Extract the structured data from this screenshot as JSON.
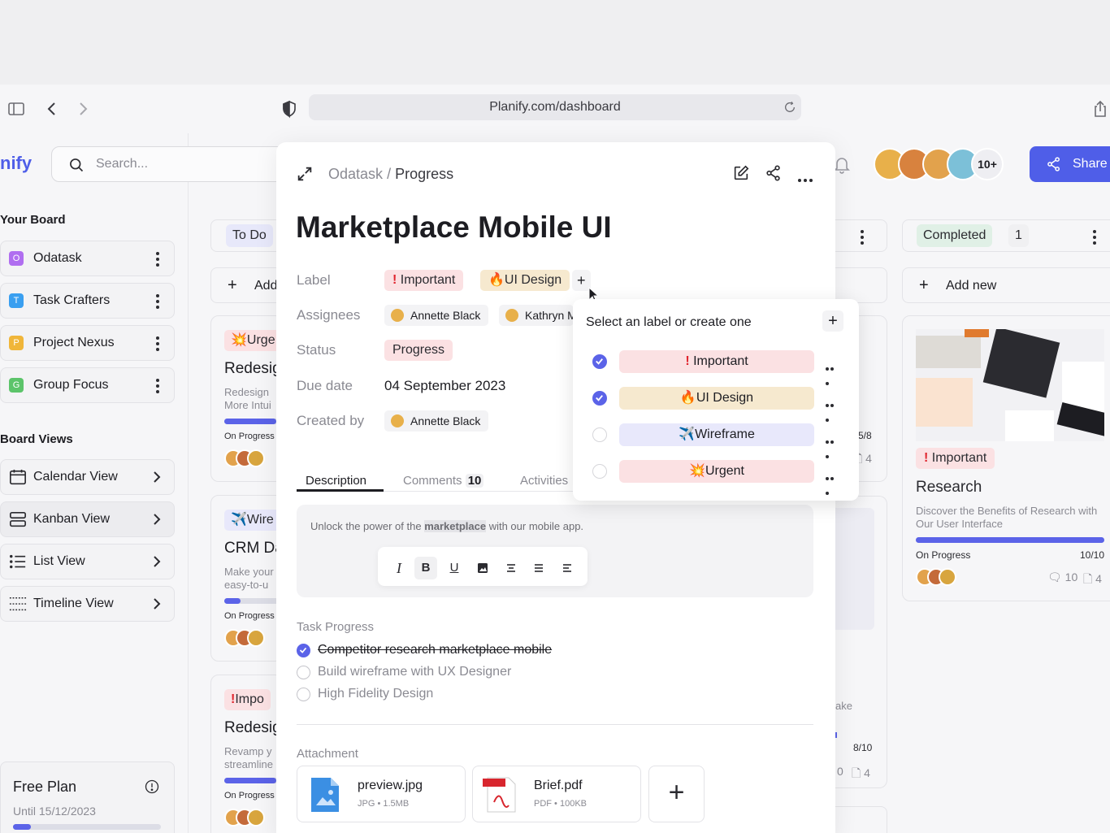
{
  "browser": {
    "url": "Planify.com/dashboard"
  },
  "app": {
    "logo": "nify",
    "search_placeholder": "Search...",
    "header": {
      "avatars_more": "10+",
      "share_label": "Share"
    }
  },
  "sidebar": {
    "boards_title": "Your Board",
    "boards": [
      {
        "initial": "O",
        "label": "Odatask",
        "color": "#b06ef0"
      },
      {
        "initial": "T",
        "label": "Task Crafters",
        "color": "#3a9ff0"
      },
      {
        "initial": "P",
        "label": "Project Nexus",
        "color": "#f0b63a"
      },
      {
        "initial": "G",
        "label": "Group Focus",
        "color": "#5cc46a"
      }
    ],
    "views_title": "Board Views",
    "views": [
      {
        "label": "Calendar View",
        "icon": "calendar-icon"
      },
      {
        "label": "Kanban View",
        "icon": "kanban-icon"
      },
      {
        "label": "List View",
        "icon": "list-icon"
      },
      {
        "label": "Timeline View",
        "icon": "timeline-icon"
      }
    ],
    "plan": {
      "title": "Free Plan",
      "until": "Until 15/12/2023",
      "progress": 0.12
    }
  },
  "board": {
    "todo": {
      "title": "To Do",
      "add_label": "Add",
      "cards": [
        {
          "tag": "Urge",
          "title": "Redesig",
          "desc1": "Redesign ",
          "desc2": "More Intui",
          "status": "On Progress"
        },
        {
          "tag": "Wire",
          "title": "CRM Da",
          "desc1": "Make your",
          "desc2": "easy-to-u",
          "status": "On Progress"
        },
        {
          "tag": "Impo",
          "title": "Redesig",
          "desc1": "Revamp y",
          "desc2": "streamline",
          "status": "On Progress"
        }
      ]
    },
    "middle": {
      "count1": "5/8",
      "files1": "4",
      "desc_fragment": "ake",
      "count2": "8/10",
      "comments2": "0",
      "files2": "4"
    },
    "completed": {
      "title": "Completed",
      "count": "1",
      "add_label": "Add new",
      "card": {
        "tag": "Important",
        "title": "Research",
        "desc": "Discover the Benefits of Research with Our User Interface",
        "status": "On Progress",
        "progress_text": "10/10",
        "progress": 1.0,
        "comments": "10",
        "files": "4"
      }
    }
  },
  "modal": {
    "breadcrumb_parent": "Odatask",
    "breadcrumb_sep": "/",
    "breadcrumb_current": "Progress",
    "title": "Marketplace Mobile UI",
    "fields": {
      "label_label": "Label",
      "assignees_label": "Assignees",
      "status_label": "Status",
      "due_label": "Due date",
      "created_label": "Created by"
    },
    "labels": [
      "Important",
      "UI Design"
    ],
    "assignees": [
      "Annette Black",
      "Kathryn M"
    ],
    "status": "Progress",
    "due_date": "04 September 2023",
    "created_by": "Annette Black",
    "tabs": {
      "description": "Description",
      "comments": "Comments",
      "comments_count": "10",
      "activities": "Activities"
    },
    "description": {
      "before": "Unlock the power of the ",
      "highlight": "marketplace",
      "after": " with our mobile app."
    },
    "task_progress_title": "Task Progress",
    "tasks": [
      {
        "label": "Competitor research marketplace mobile",
        "done": true
      },
      {
        "label": "Build wireframe with UX Designer",
        "done": false
      },
      {
        "label": "High Fidelity Design",
        "done": false
      }
    ],
    "attachment_title": "Attachment",
    "attachments": [
      {
        "name": "preview.jpg",
        "type": "JPG",
        "size": "1.5MB"
      },
      {
        "name": "Brief.pdf",
        "type": "PDF",
        "size": "100KB"
      }
    ]
  },
  "label_popup": {
    "title": "Select an label or create one",
    "options": [
      {
        "label": "Important",
        "checked": true,
        "bg": "#fbe1e3"
      },
      {
        "label": "UI Design",
        "checked": true,
        "bg": "#f6e9cf"
      },
      {
        "label": "Wireframe",
        "checked": false,
        "bg": "#e8e8fb"
      },
      {
        "label": "Urgent",
        "checked": false,
        "bg": "#fbe1e3"
      }
    ]
  },
  "colors": {
    "accent": "#5b63e8",
    "share_bg": "#4f5ee8"
  }
}
